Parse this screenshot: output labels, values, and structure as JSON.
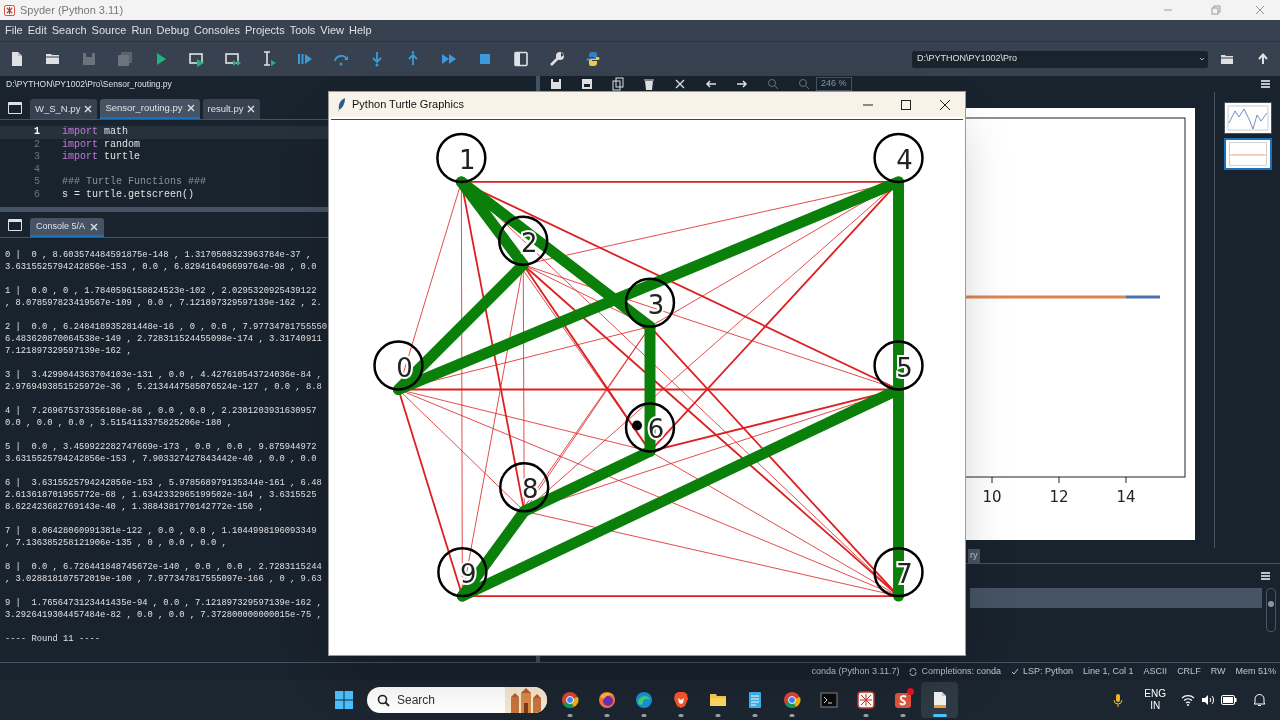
{
  "window": {
    "title": "Spyder (Python 3.11)"
  },
  "menu": [
    "File",
    "Edit",
    "Search",
    "Source",
    "Run",
    "Debug",
    "Consoles",
    "Projects",
    "Tools",
    "View",
    "Help"
  ],
  "working_directory": "D:\\PYTHON\\PY1002\\Pro",
  "editor": {
    "file_path": "D:\\PYTHON\\PY1002\\Pro\\Sensor_routing.py",
    "tabs": [
      {
        "label": "W_S_N.py",
        "selected": false
      },
      {
        "label": "Sensor_routing.py",
        "selected": true
      },
      {
        "label": "result.py",
        "selected": false
      }
    ],
    "lines": [
      {
        "number": "1",
        "current": true,
        "tokens": [
          {
            "text": "import",
            "kind": "keyword"
          },
          {
            "text": " math",
            "kind": "plain"
          }
        ]
      },
      {
        "number": "2",
        "current": false,
        "tokens": [
          {
            "text": "import",
            "kind": "keyword"
          },
          {
            "text": " random",
            "kind": "plain"
          }
        ]
      },
      {
        "number": "3",
        "current": false,
        "tokens": [
          {
            "text": "import",
            "kind": "keyword"
          },
          {
            "text": " turtle",
            "kind": "plain"
          }
        ]
      },
      {
        "number": "4",
        "current": false
      },
      {
        "number": "5",
        "current": false,
        "tokens": [
          {
            "text": "### Turtle Functions ###",
            "kind": "comment"
          }
        ]
      },
      {
        "number": "6",
        "current": false,
        "tokens": [
          {
            "text": "s = turtle.getscreen()",
            "kind": "plain"
          }
        ]
      }
    ]
  },
  "console": {
    "tab": {
      "label": "Console 5/A",
      "selected": true
    },
    "blocks": [
      [
        "0 |  0 , 8.603574484591875e-148 , 1.3170508323963784e-37 ,",
        "3.6315525794242856e-153 , 0.0 , 6.829416496699764e-98 , 0.0"
      ],
      [
        "1 |  0.0 , 0 , 1.7840596158824523e-102 , 2.0295320925439122",
        ", 8.078597823419567e-109 , 0.0 , 7.121897329597139e-162 , 2."
      ],
      [
        "2 |  0.0 , 6.248418935281448e-16 , 0 , 0.0 , 7.97734781755550",
        "6.483620870064538e-149 , 2.728311524455098e-174 , 3.31740911",
        "7.121897329597139e-162 ,"
      ],
      [
        "3 |  3.4299044363704103e-131 , 0.0 , 4.427610543724036e-84 ,",
        "2.9769493851525972e-36 , 5.2134447585076524e-127 , 0.0 , 8.8"
      ],
      [
        "4 |  7.269675373356108e-86 , 0.0 , 0.0 , 2.2301203931630957",
        "0.0 , 0.0 , 0.0 , 3.5154113375825206e-180 ,"
      ],
      [
        "5 |  0.0 , 3.459922282747669e-173 , 0.0 , 0.0 , 9.875944972",
        "3.6315525794242856e-153 , 7.903327427843442e-40 , 0.0 , 0.0"
      ],
      [
        "6 |  3.6315525794242856e-153 , 5.978568979135344e-161 , 6.48",
        "2.613618701955772e-68 , 1.6342332965199502e-164 , 3.6315525",
        "8.622423682769143e-40 , 1.3884381770142772e-150 ,"
      ],
      [
        "7 |  8.06428060991381e-122 , 0.0 , 0.0 , 1.1044998196093349",
        ", 7.136385258121906e-135 , 0 , 0.0 , 0.0 ,"
      ],
      [
        "8 |  0.0 , 6.726441848745672e-140 , 0.0 , 0.0 , 2.7283115244",
        ", 3.028818107572019e-100 , 7.977347817555097e-166 , 0 , 9.63"
      ],
      [
        "9 |  1.7656473123441435e-94 , 0.0 , 7.121897329597139e-162 ,",
        "3.2926419304457484e-82 , 0.0 , 0.0 , 7.372800000000015e-75 ,"
      ]
    ],
    "footer": "---- Round 11 ----"
  },
  "plots": {
    "zoom": "246 %",
    "xtick_labels": [
      "10",
      "12",
      "14"
    ],
    "thumbnails": [
      {
        "selected": false
      },
      {
        "selected": true
      }
    ],
    "pane_tab": "ry"
  },
  "turtle": {
    "title": "Python Turtle Graphics",
    "nodes": [
      {
        "label": "0"
      },
      {
        "label": "1"
      },
      {
        "label": "2"
      },
      {
        "label": "3"
      },
      {
        "label": "4"
      },
      {
        "label": "5"
      },
      {
        "label": "6"
      },
      {
        "label": "7"
      },
      {
        "label": "8"
      },
      {
        "label": "9"
      }
    ]
  },
  "status_bar": [
    {
      "text": "conda (Python 3.11.7)",
      "kind": "plain"
    },
    {
      "text": "Completions: conda",
      "kind": "sync"
    },
    {
      "text": "LSP: Python",
      "kind": "check"
    },
    {
      "text": "Line 1, Col 1",
      "kind": "plain"
    },
    {
      "text": "ASCII",
      "kind": "plain"
    },
    {
      "text": "CRLF",
      "kind": "plain"
    },
    {
      "text": "RW",
      "kind": "plain"
    },
    {
      "text": "Mem 51%",
      "kind": "plain"
    }
  ],
  "taskbar": {
    "search_placeholder": "Search",
    "apps": [
      {
        "kind": "chrome",
        "running": true,
        "selected": false,
        "badge": false
      },
      {
        "kind": "firefox",
        "running": true,
        "selected": false,
        "badge": false
      },
      {
        "kind": "edge",
        "running": true,
        "selected": false,
        "badge": false
      },
      {
        "kind": "brave",
        "running": true,
        "selected": false,
        "badge": false
      },
      {
        "kind": "folder",
        "running": true,
        "selected": false,
        "badge": false
      },
      {
        "kind": "notepad",
        "running": true,
        "selected": false,
        "badge": false
      },
      {
        "kind": "chrome",
        "running": true,
        "selected": false,
        "badge": false
      },
      {
        "kind": "terminal",
        "running": false,
        "selected": false,
        "badge": false
      },
      {
        "kind": "spyder",
        "running": true,
        "selected": false,
        "badge": false
      },
      {
        "kind": "app",
        "running": true,
        "selected": false,
        "badge": true
      },
      {
        "kind": "file",
        "running": true,
        "selected": true,
        "badge": false
      }
    ],
    "language": "ENG",
    "region": "IN"
  }
}
